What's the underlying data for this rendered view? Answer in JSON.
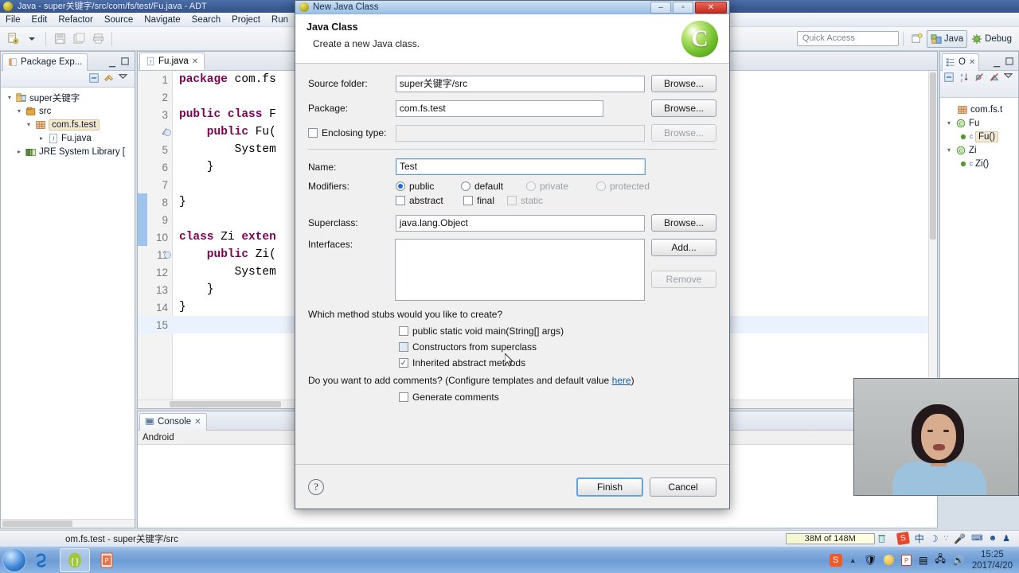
{
  "window": {
    "title": "Java - super关键字/src/com/fs/test/Fu.java - ADT",
    "icon": "eclipse-icon"
  },
  "menubar": {
    "items": [
      "File",
      "Edit",
      "Refactor",
      "Source",
      "Navigate",
      "Search",
      "Project",
      "Run"
    ]
  },
  "toolbar": {
    "quick_access_placeholder": "Quick Access",
    "perspectives": [
      {
        "label": "Java",
        "active": true
      },
      {
        "label": "Debug",
        "active": false
      }
    ]
  },
  "package_explorer": {
    "tab_label": "Package Exp...",
    "tree": [
      {
        "label": "super关键字",
        "depth": 0,
        "icon": "project-icon",
        "expanded": true,
        "selected": false
      },
      {
        "label": "src",
        "depth": 1,
        "icon": "source-folder-icon",
        "expanded": true,
        "selected": false
      },
      {
        "label": "com.fs.test",
        "depth": 2,
        "icon": "package-icon",
        "expanded": true,
        "selected": true
      },
      {
        "label": "Fu.java",
        "depth": 3,
        "icon": "java-file-icon",
        "expanded": false,
        "selected": false
      },
      {
        "label": "JRE System Library [",
        "depth": 1,
        "icon": "library-icon",
        "expanded": false,
        "selected": false
      }
    ]
  },
  "editor": {
    "tab_label": "Fu.java",
    "tab_icon": "java-file-icon",
    "lines": [
      {
        "n": "1",
        "segments": [
          {
            "t": "package",
            "k": "kw"
          },
          {
            "t": " com.fs",
            "k": "plain"
          }
        ]
      },
      {
        "n": "2",
        "segments": []
      },
      {
        "n": "3",
        "segments": [
          {
            "t": "public class",
            "k": "kw"
          },
          {
            "t": " F",
            "k": "plain"
          }
        ]
      },
      {
        "n": "4",
        "segments": [
          {
            "t": "    public",
            "k": "kw"
          },
          {
            "t": " Fu(",
            "k": "plain"
          }
        ]
      },
      {
        "n": "5",
        "segments": [
          {
            "t": "        System",
            "k": "plain"
          }
        ]
      },
      {
        "n": "6",
        "segments": [
          {
            "t": "    }",
            "k": "plain"
          }
        ]
      },
      {
        "n": "7",
        "segments": []
      },
      {
        "n": "8",
        "segments": [
          {
            "t": "}",
            "k": "plain"
          }
        ]
      },
      {
        "n": "9",
        "segments": []
      },
      {
        "n": "10",
        "segments": [
          {
            "t": "class",
            "k": "kw"
          },
          {
            "t": " Zi ",
            "k": "plain"
          },
          {
            "t": "exten",
            "k": "kw"
          }
        ]
      },
      {
        "n": "11",
        "segments": [
          {
            "t": "    public",
            "k": "kw"
          },
          {
            "t": " Zi(",
            "k": "plain"
          }
        ]
      },
      {
        "n": "12",
        "segments": [
          {
            "t": "        System",
            "k": "plain"
          }
        ]
      },
      {
        "n": "13",
        "segments": [
          {
            "t": "    }",
            "k": "plain"
          }
        ]
      },
      {
        "n": "14",
        "segments": [
          {
            "t": "}",
            "k": "plain"
          }
        ]
      },
      {
        "n": "15",
        "segments": []
      }
    ]
  },
  "outline": {
    "tab_label": "O",
    "tree": [
      {
        "label": "com.fs.t",
        "depth": 1,
        "icon": "package-icon",
        "expanded": false,
        "selected": false
      },
      {
        "label": "Fu",
        "depth": 0,
        "icon": "class-icon",
        "expanded": true,
        "selected": false
      },
      {
        "label": "Fu()",
        "depth": 1,
        "icon": "constructor-icon",
        "expanded": false,
        "selected": true
      },
      {
        "label": "Zi",
        "depth": 0,
        "icon": "class-icon",
        "expanded": true,
        "selected": false
      },
      {
        "label": "Zi()",
        "depth": 1,
        "icon": "constructor-icon",
        "expanded": false,
        "selected": false
      }
    ]
  },
  "console": {
    "tab_label": "Console",
    "sub_label": "Android"
  },
  "statusbar": {
    "selection": "om.fs.test - super关键字/src",
    "memory": "38M of 148M",
    "trash_icon": "trash-icon",
    "tray": [
      "sogou-icon",
      "ime-cn-icon",
      "moon-icon",
      "dots-icon",
      "mic-icon",
      "keyboard-icon",
      "user-icon",
      "shirt-icon"
    ]
  },
  "taskbar": {
    "start_icon": "windows-start-icon",
    "items": [
      {
        "icon": "sogou-browser-icon",
        "active": false
      },
      {
        "icon": "eclipse-adt-icon",
        "active": true
      },
      {
        "icon": "powerpoint-icon",
        "active": false
      }
    ],
    "tray": [
      "sogou-icon",
      "show-hidden-icon",
      "security-icon",
      "update-icon",
      "pdf-icon",
      "device-icon",
      "network-icon",
      "volume-icon"
    ],
    "clock_time": "15:25",
    "clock_date": "2017/4/20"
  },
  "dialog": {
    "title": "New Java Class",
    "title_icon": "eclipse-icon",
    "window_buttons": {
      "minimize": "–",
      "maximize": "▫",
      "close": "✕"
    },
    "heading": "Java Class",
    "subheading": "Create a new Java class.",
    "badge_glyph": "C",
    "fields": {
      "source_folder": {
        "label": "Source folder:",
        "value": "super关键字/src",
        "browse_label": "Browse...",
        "browse_enabled": true
      },
      "package": {
        "label": "Package:",
        "value": "com.fs.test",
        "browse_label": "Browse...",
        "browse_enabled": true
      },
      "enclosing_type": {
        "label": "Enclosing type:",
        "checked": false,
        "value": "",
        "browse_label": "Browse...",
        "browse_enabled": false
      },
      "name": {
        "label": "Name:",
        "value": "Test"
      },
      "modifiers": {
        "label": "Modifiers:",
        "radios": [
          {
            "label": "public",
            "selected": true,
            "enabled": true
          },
          {
            "label": "default",
            "selected": false,
            "enabled": true
          },
          {
            "label": "private",
            "selected": false,
            "enabled": false
          },
          {
            "label": "protected",
            "selected": false,
            "enabled": false
          }
        ],
        "checks": [
          {
            "label": "abstract",
            "checked": false,
            "enabled": true
          },
          {
            "label": "final",
            "checked": false,
            "enabled": true
          },
          {
            "label": "static",
            "checked": false,
            "enabled": false
          }
        ]
      },
      "superclass": {
        "label": "Superclass:",
        "value": "java.lang.Object",
        "browse_label": "Browse...",
        "browse_enabled": true
      },
      "interfaces": {
        "label": "Interfaces:",
        "items": [],
        "add_label": "Add...",
        "remove_label": "Remove",
        "remove_enabled": false
      }
    },
    "stubs": {
      "question": "Which method stubs would you like to create?",
      "options": [
        {
          "label": "public static void main(String[] args)",
          "checked": false
        },
        {
          "label": "Constructors from superclass",
          "checked": false
        },
        {
          "label": "Inherited abstract methods",
          "checked": true
        }
      ]
    },
    "comments": {
      "question_prefix": "Do you want to add comments? (Configure templates and default value ",
      "link_label": "here",
      "question_suffix": ")",
      "option": {
        "label": "Generate comments",
        "checked": false
      }
    },
    "footer": {
      "help_glyph": "?",
      "finish_label": "Finish",
      "cancel_label": "Cancel"
    }
  },
  "webcam": {
    "label": "presenter-video"
  }
}
